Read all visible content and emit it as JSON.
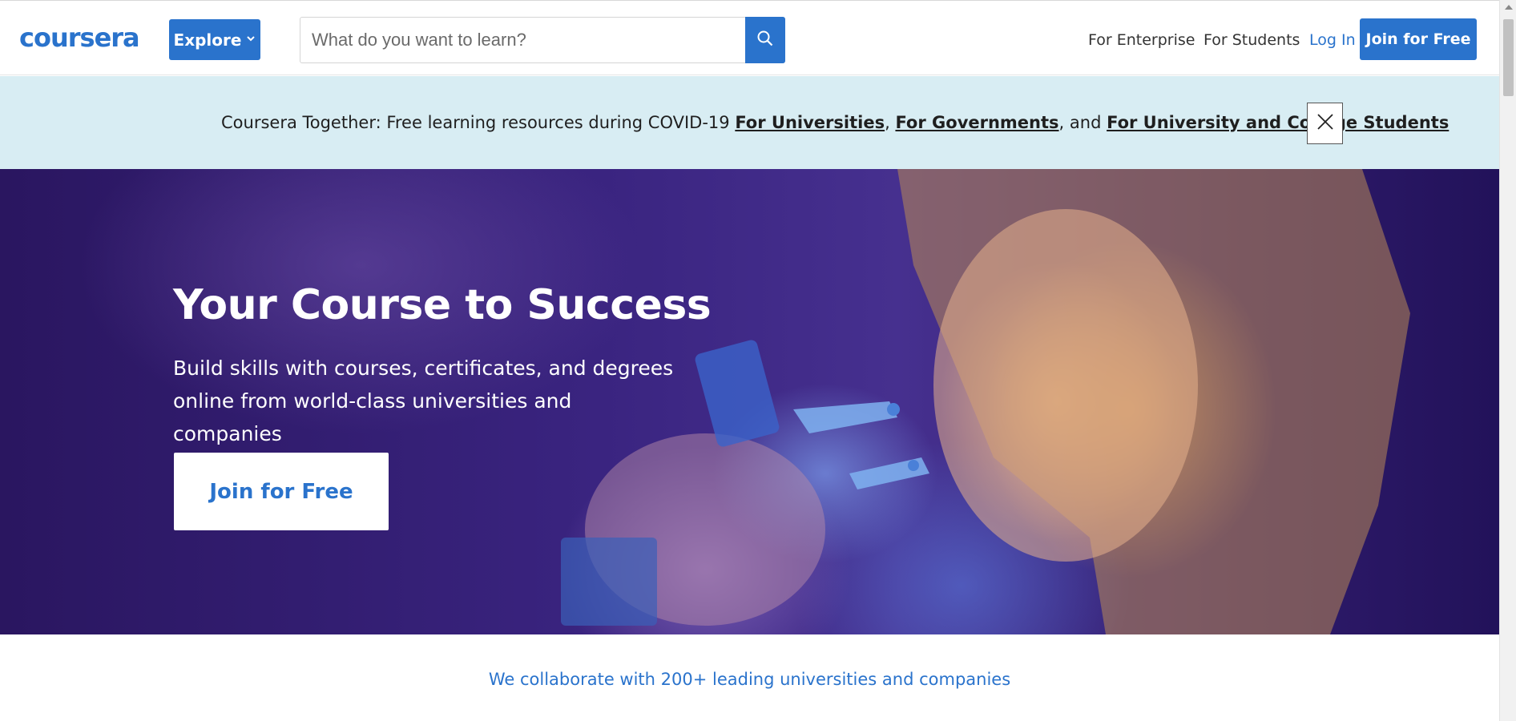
{
  "header": {
    "logo_text": "coursera",
    "explore_label": "Explore",
    "search_placeholder": "What do you want to learn?",
    "nav_enterprise": "For Enterprise",
    "nav_students": "For Students",
    "nav_login": "Log In",
    "join_label": "Join for Free"
  },
  "banner": {
    "prefix": "Coursera Together: Free learning resources during COVID-19 ",
    "link_universities": "For Universities",
    "sep1": ", ",
    "link_governments": "For Governments",
    "sep2": ", and ",
    "link_students": "For University and College Students"
  },
  "hero": {
    "title": "Your Course to Success",
    "subtitle": "Build skills with courses, certificates, and degrees online from world-class universities and companies",
    "cta_label": "Join for Free"
  },
  "collab_text": "We collaborate with 200+ leading universities and companies",
  "colors": {
    "brand_blue": "#2a73cc",
    "banner_bg": "#d8edf3",
    "hero_bg": "#2a1660"
  },
  "icons": {
    "explore_chevron": "chevron-down-icon",
    "search": "search-icon",
    "banner_close": "close-icon"
  }
}
